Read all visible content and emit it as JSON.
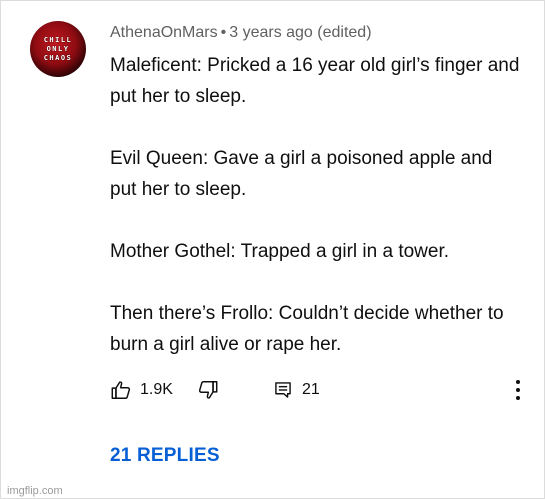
{
  "avatar": {
    "lines": [
      "CHILL",
      "ONLY",
      "CHAOS"
    ]
  },
  "comment_header": {
    "author": "AthenaOnMars",
    "separator": "•",
    "timestamp": "3 years ago (edited)"
  },
  "comment_body": {
    "paragraphs": [
      "Maleficent: Pricked a 16 year old girl’s finger and put her to sleep.",
      "Evil Queen: Gave a girl a poisoned apple and put her to sleep.",
      "Mother Gothel: Trapped a girl in a tower.",
      "Then there’s Frollo: Couldn’t decide whether to burn a girl alive or rape her."
    ]
  },
  "actions": {
    "like_icon": "thumbs-up-icon",
    "like_count": "1.9K",
    "dislike_icon": "thumbs-down-icon",
    "reply_icon": "reply-comment-icon",
    "reply_count": "21",
    "more_icon": "more-vertical-icon"
  },
  "replies_link": {
    "label": "21 REPLIES",
    "color": "#065fd4"
  },
  "watermark": {
    "text": "imgflip.com"
  }
}
